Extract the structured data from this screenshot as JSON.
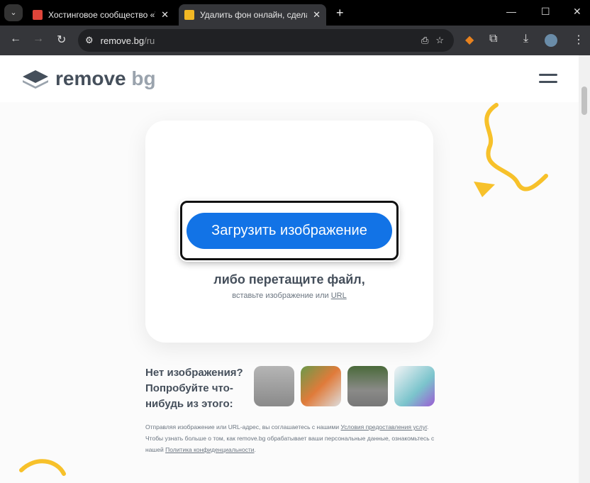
{
  "browser": {
    "tabs": [
      {
        "title": "Хостинговое сообщество «Tim",
        "color": "#e0453a"
      },
      {
        "title": "Удалить фон онлайн, сделать п",
        "color": "#f2b824"
      }
    ],
    "url_host": "remove.bg",
    "url_path": "/ru"
  },
  "header": {
    "logo_main": "remove",
    "logo_bg": "bg"
  },
  "upload": {
    "button": "Загрузить изображение",
    "drop_text": "либо перетащите файл,",
    "paste_text": "вставьте изображение или ",
    "url_link": "URL"
  },
  "samples": {
    "heading": "Нет изображения? Попробуйте что-нибудь из этого:",
    "items": [
      "woman",
      "pigeon",
      "car",
      "fitness gear"
    ]
  },
  "legal": {
    "p1": "Отправляя изображение или URL-адрес, вы соглашаетесь с нашими ",
    "terms": "Условия предоставления услуг",
    "p2": ". Чтобы узнать больше о том, как ",
    "brand": "remove.bg",
    "p3": " обрабатывает ваши персональные данные, ознакомьтесь с нашей ",
    "privacy": "Политика конфиденциальности",
    "p4": "."
  }
}
